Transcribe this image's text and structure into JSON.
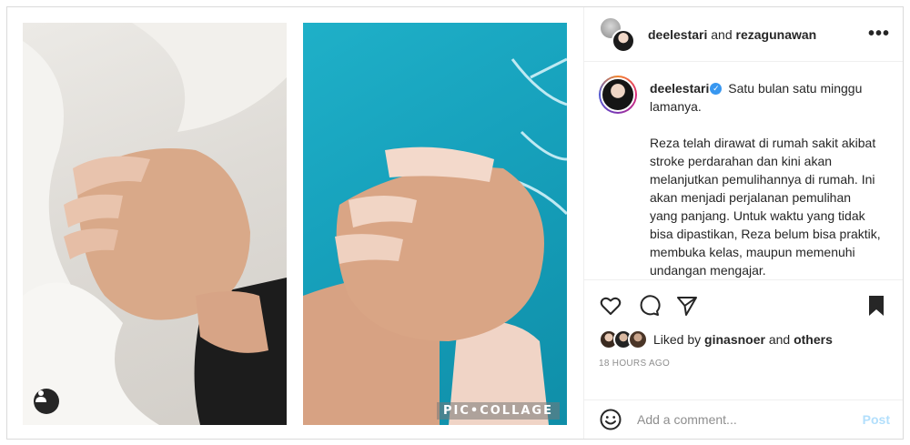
{
  "header": {
    "user1": "deelestari",
    "joiner": "and",
    "user2": "rezagunawan",
    "more_icon": "more-horizontal-icon"
  },
  "media": {
    "watermark": "PIC•COLLAGE",
    "tag_icon": "user-tag-icon",
    "colors": {
      "sheet": "#e4e1dc",
      "blanket": "#17a2bd"
    }
  },
  "caption": {
    "username": "deelestari",
    "verified_icon": "verified-badge-icon",
    "line1": "Satu bulan satu minggu lamanya.",
    "paragraph": "Reza telah dirawat di rumah sakit akibat stroke perdarahan dan kini akan melanjutkan pemulihannya di rumah. Ini akan menjadi perjalanan pemulihan yang panjang. Untuk waktu yang tidak bisa dipastikan, Reza belum bisa praktik, membuka kelas, maupun memenuhi undangan mengajar."
  },
  "actions": {
    "icons": [
      "heart-icon",
      "comment-icon",
      "share-icon",
      "bookmark-icon"
    ]
  },
  "likes": {
    "prefix": "Liked by",
    "user": "ginasnoer",
    "joiner": "and",
    "others": "others"
  },
  "timestamp": "18 HOURS AGO",
  "comment": {
    "placeholder": "Add a comment...",
    "post_label": "Post",
    "post_color": "#b2dffc"
  }
}
